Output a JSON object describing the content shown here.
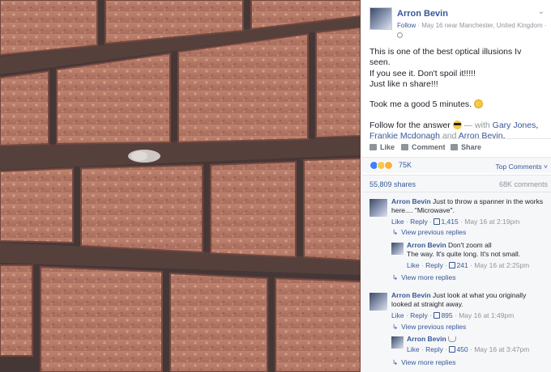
{
  "post": {
    "author": "Arron Bevin",
    "follow_label": "Follow",
    "meta": " · May 16 near Manchester, United Kingdom ·",
    "text_line1": "This is one of the best optical illusions Iv seen.",
    "text_line2": "If you see it. Don't spoil it!!!!!",
    "text_line3": "Just like n share!!!",
    "text_line4": "Took me a good 5 minutes.",
    "text_line5_a": "Follow for the answer",
    "text_line5_b": " — with ",
    "tag1": "Gary Jones",
    "sep1": ", ",
    "tag2": "Frankie Mcdonagh",
    "sep2": " and ",
    "tag3": "Arron Bevin",
    "end": "."
  },
  "actions": {
    "like": "Like",
    "comment": "Comment",
    "share": "Share"
  },
  "reactions": {
    "count": "75K",
    "top_comments": "Top Comments ˅"
  },
  "stats": {
    "shares": "55,809 shares",
    "comments": "68K comments"
  },
  "comments": [
    {
      "author": "Arron Bevin",
      "text": "Just to throw a spanner in the works here.... \"Microwave\".",
      "like": "Like",
      "reply": "Reply",
      "likes": "1,415",
      "time": "May 16 at 2:19pm"
    },
    {
      "author": "Arron Bevin",
      "text": "Don't zoom all",
      "text2": "The way. It's quite long. It's not small.",
      "like": "Like",
      "reply": "Reply",
      "likes": "241",
      "time": "May 16 at 2:25pm"
    },
    {
      "author": "Arron Bevin",
      "text": "Just look at what you originally looked at straight away.",
      "like": "Like",
      "reply": "Reply",
      "likes": "895",
      "time": "May 16 at 1:49pm"
    },
    {
      "author": "Arron Bevin",
      "like": "Like",
      "reply": "Reply",
      "likes": "450",
      "time": "May 16 at 3:47pm"
    }
  ],
  "links": {
    "view_previous_replies": "View previous replies",
    "view_more_replies": "View more replies"
  },
  "colors": {
    "link": "#365899",
    "muted": "#90949c",
    "panel_bg": "#f6f7f9"
  },
  "icons": [
    "chevron-down-icon",
    "globe-icon",
    "like-icon",
    "comment-icon",
    "share-icon",
    "thumb-icon",
    "reply-arrow-icon"
  ]
}
